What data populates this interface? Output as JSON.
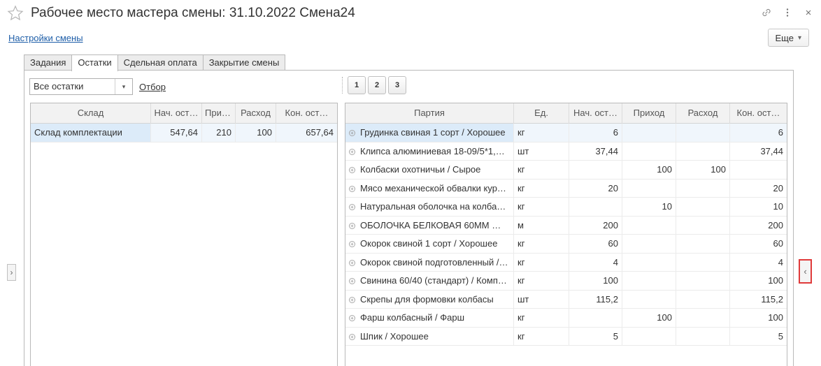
{
  "window": {
    "title": "Рабочее место мастера смены: 31.10.2022 Смена24",
    "icons": [
      "star-icon",
      "link-icon",
      "more-vertical-icon",
      "close-icon"
    ]
  },
  "header": {
    "settings_link": "Настройки смены",
    "more_button": "Еще",
    "more_arrow": "▾"
  },
  "tabs": [
    {
      "label": "Задания",
      "active": false
    },
    {
      "label": "Остатки",
      "active": true
    },
    {
      "label": "Сдельная оплата",
      "active": false
    },
    {
      "label": "Закрытие смены",
      "active": false
    }
  ],
  "filter": {
    "combo_value": "Все остатки",
    "combo_arrow": "▾",
    "filter_link": "Отбор"
  },
  "pages": [
    "1",
    "2",
    "3"
  ],
  "warehouse_table": {
    "columns": [
      "Склад",
      "Нач. ост…",
      "Прих…",
      "Расход",
      "Кон. ост…"
    ],
    "rows": [
      {
        "name": "Склад комплектации",
        "start": "547,64",
        "in": "210",
        "out": "100",
        "end": "657,64"
      }
    ]
  },
  "batch_table": {
    "columns": [
      "Партия",
      "Ед.",
      "Нач. ост…",
      "Приход",
      "Расход",
      "Кон. ост…"
    ],
    "expander": "+",
    "rows": [
      {
        "name": "Грудинка свиная 1 сорт / Хорошее",
        "unit": "кг",
        "start": "6",
        "in": "",
        "out": "",
        "end": "6"
      },
      {
        "name": "Клипса алюминиевая 18-09/5*1,…",
        "unit": "шт",
        "start": "37,44",
        "in": "",
        "out": "",
        "end": "37,44"
      },
      {
        "name": "Колбаски охотничьи / Сырое",
        "unit": "кг",
        "start": "",
        "in": "100",
        "out": "100",
        "end": ""
      },
      {
        "name": "Мясо механической обвалки кур…",
        "unit": "кг",
        "start": "20",
        "in": "",
        "out": "",
        "end": "20"
      },
      {
        "name": "Натуральная оболочка на колба…",
        "unit": "кг",
        "start": "",
        "in": "10",
        "out": "",
        "end": "10"
      },
      {
        "name": "ОБОЛОЧКА БЕЛКОВАЯ 60ММ …",
        "unit": "м",
        "start": "200",
        "in": "",
        "out": "",
        "end": "200"
      },
      {
        "name": "Окорок свиной 1 сорт / Хорошее",
        "unit": "кг",
        "start": "60",
        "in": "",
        "out": "",
        "end": "60"
      },
      {
        "name": "Окорок свиной подготовленный /…",
        "unit": "кг",
        "start": "4",
        "in": "",
        "out": "",
        "end": "4"
      },
      {
        "name": "Свинина 60/40 (стандарт) / Комп…",
        "unit": "кг",
        "start": "100",
        "in": "",
        "out": "",
        "end": "100"
      },
      {
        "name": "Скрепы для формовки колбасы",
        "unit": "шт",
        "start": "115,2",
        "in": "",
        "out": "",
        "end": "115,2"
      },
      {
        "name": "Фарш колбасный / Фарш",
        "unit": "кг",
        "start": "",
        "in": "100",
        "out": "",
        "end": "100"
      },
      {
        "name": "Шпик / Хорошее",
        "unit": "кг",
        "start": "5",
        "in": "",
        "out": "",
        "end": "5"
      }
    ]
  },
  "side_buttons": {
    "left": "›",
    "right": "‹"
  },
  "colors": {
    "link": "#1e5ea8",
    "selection": "#dcebf9",
    "highlight_border": "#e03a3a"
  }
}
